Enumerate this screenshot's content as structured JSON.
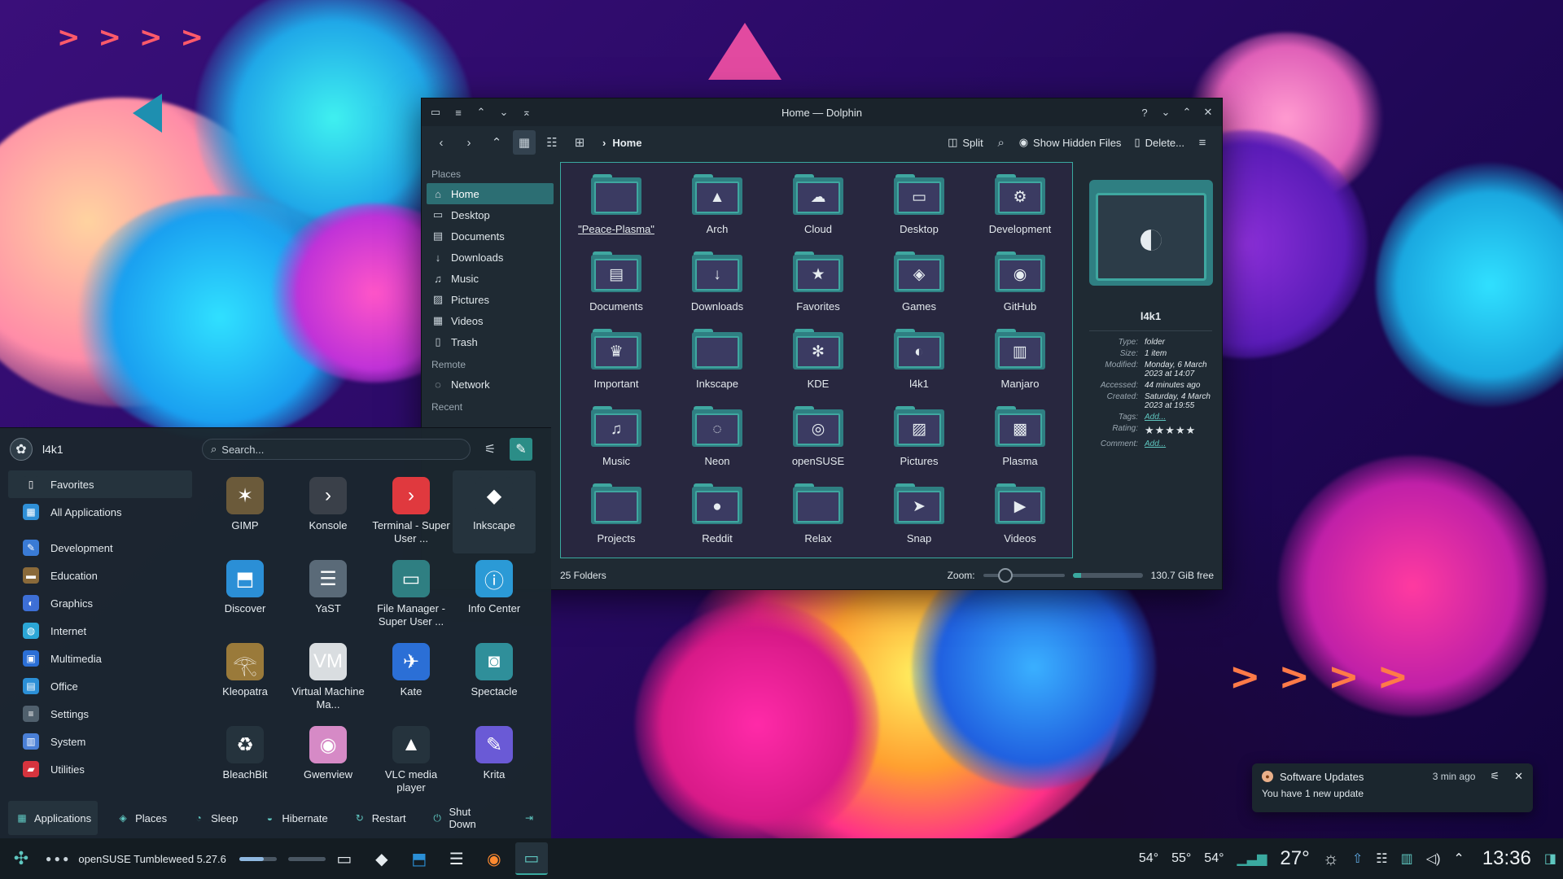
{
  "dolphin": {
    "title": "Home — Dolphin",
    "breadcrumb": "Home",
    "toolbar": {
      "split": "Split",
      "hidden": "Show Hidden Files",
      "delete": "Delete..."
    },
    "places_header": "Places",
    "remote_header": "Remote",
    "recent_header": "Recent",
    "places": [
      "Home",
      "Desktop",
      "Documents",
      "Downloads",
      "Music",
      "Pictures",
      "Videos",
      "Trash"
    ],
    "remote": [
      "Network"
    ],
    "folders": [
      {
        "name": "\"Peace-Plasma\"",
        "icon": "blank-folder-icon",
        "glyph": ""
      },
      {
        "name": "Arch",
        "icon": "arch-icon",
        "glyph": "▲"
      },
      {
        "name": "Cloud",
        "icon": "cloud-icon",
        "glyph": "☁"
      },
      {
        "name": "Desktop",
        "icon": "desktop-icon",
        "glyph": "▭"
      },
      {
        "name": "Development",
        "icon": "gear-icon",
        "glyph": "⚙"
      },
      {
        "name": "Documents",
        "icon": "document-icon",
        "glyph": "▤"
      },
      {
        "name": "Downloads",
        "icon": "download-icon",
        "glyph": "↓"
      },
      {
        "name": "Favorites",
        "icon": "star-icon",
        "glyph": "★"
      },
      {
        "name": "Games",
        "icon": "gamepad-icon",
        "glyph": "◈"
      },
      {
        "name": "GitHub",
        "icon": "github-icon",
        "glyph": "◉"
      },
      {
        "name": "Important",
        "icon": "trophy-icon",
        "glyph": "♛"
      },
      {
        "name": "Inkscape",
        "icon": "blank-folder-icon",
        "glyph": ""
      },
      {
        "name": "KDE",
        "icon": "kde-icon",
        "glyph": "✻"
      },
      {
        "name": "l4k1",
        "icon": "chameleon-icon",
        "glyph": "◐"
      },
      {
        "name": "Manjaro",
        "icon": "manjaro-icon",
        "glyph": "▥"
      },
      {
        "name": "Music",
        "icon": "music-icon",
        "glyph": "♫"
      },
      {
        "name": "Neon",
        "icon": "neon-icon",
        "glyph": "◌"
      },
      {
        "name": "openSUSE",
        "icon": "opensuse-icon",
        "glyph": "◎"
      },
      {
        "name": "Pictures",
        "icon": "picture-icon",
        "glyph": "▨"
      },
      {
        "name": "Plasma",
        "icon": "plasma-icon",
        "glyph": "▩"
      },
      {
        "name": "Projects",
        "icon": "blank-folder-icon",
        "glyph": ""
      },
      {
        "name": "Reddit",
        "icon": "reddit-icon",
        "glyph": "●"
      },
      {
        "name": "Relax",
        "icon": "blank-folder-icon",
        "glyph": ""
      },
      {
        "name": "Snap",
        "icon": "snap-icon",
        "glyph": "➤"
      },
      {
        "name": "Videos",
        "icon": "video-icon",
        "glyph": "▶"
      }
    ],
    "status_count": "25 Folders",
    "zoom_label": "Zoom:",
    "free_space": "130.7 GiB free",
    "capacity_used": 0.12,
    "info": {
      "name": "l4k1",
      "type_k": "Type:",
      "type_v": "folder",
      "size_k": "Size:",
      "size_v": "1 item",
      "modified_k": "Modified:",
      "modified_v": "Monday, 6 March 2023 at 14:07",
      "accessed_k": "Accessed:",
      "accessed_v": "44 minutes ago",
      "created_k": "Created:",
      "created_v": "Saturday, 4 March 2023 at 19:55",
      "tags_k": "Tags:",
      "tags_v": "Add...",
      "rating_k": "Rating:",
      "rating_v": "★★★★★",
      "comment_k": "Comment:",
      "comment_v": "Add..."
    }
  },
  "launcher": {
    "user": "l4k1",
    "search_placeholder": "Search...",
    "categories": [
      {
        "label": "Favorites",
        "icon": "bookmark-icon",
        "color": "#25333d",
        "glyph": "▯"
      },
      {
        "label": "All Applications",
        "icon": "grid-icon",
        "color": "#2f8fd6",
        "glyph": "▦"
      },
      {
        "label": "Development",
        "icon": "hammer-icon",
        "color": "#3a7bd5",
        "glyph": "✎"
      },
      {
        "label": "Education",
        "icon": "chalkboard-icon",
        "color": "#8a6a3a",
        "glyph": "▬"
      },
      {
        "label": "Graphics",
        "icon": "palette-icon",
        "color": "#3d6fd6",
        "glyph": "◐"
      },
      {
        "label": "Internet",
        "icon": "globe-icon",
        "color": "#2ba6d6",
        "glyph": "◍"
      },
      {
        "label": "Multimedia",
        "icon": "media-icon",
        "color": "#2b6fd6",
        "glyph": "▣"
      },
      {
        "label": "Office",
        "icon": "office-icon",
        "color": "#2b8fd6",
        "glyph": "▤"
      },
      {
        "label": "Settings",
        "icon": "settings-icon",
        "color": "#50606d",
        "glyph": "≡"
      },
      {
        "label": "System",
        "icon": "system-icon",
        "color": "#4a7fd6",
        "glyph": "▥"
      },
      {
        "label": "Utilities",
        "icon": "toolbox-icon",
        "color": "#d6343e",
        "glyph": "▰"
      }
    ],
    "apps": [
      {
        "label": "GIMP",
        "icon": "gimp-icon",
        "color": "#6b5a3a",
        "glyph": "✶"
      },
      {
        "label": "Konsole",
        "icon": "konsole-icon",
        "color": "#3a4049",
        "glyph": "›"
      },
      {
        "label": "Terminal - Super User ...",
        "icon": "terminal-root-icon",
        "color": "#e0393e",
        "glyph": "›"
      },
      {
        "label": "Inkscape",
        "icon": "inkscape-icon",
        "color": "#25333d",
        "glyph": "◆"
      },
      {
        "label": "Discover",
        "icon": "discover-icon",
        "color": "#2b8fd6",
        "glyph": "⬒"
      },
      {
        "label": "YaST",
        "icon": "yast-icon",
        "color": "#5a6a78",
        "glyph": "☰"
      },
      {
        "label": "File Manager - Super User ...",
        "icon": "folder-root-icon",
        "color": "#2f7f82",
        "glyph": "▭"
      },
      {
        "label": "Info Center",
        "icon": "info-icon",
        "color": "#2b9ad6",
        "glyph": "ⓘ"
      },
      {
        "label": "Kleopatra",
        "icon": "kleopatra-icon",
        "color": "#9a7a3a",
        "glyph": "𓂀"
      },
      {
        "label": "Virtual Machine Ma...",
        "icon": "vm-icon",
        "color": "#d9dde0",
        "glyph": "VM"
      },
      {
        "label": "Kate",
        "icon": "kate-icon",
        "color": "#2b6fd6",
        "glyph": "✈"
      },
      {
        "label": "Spectacle",
        "icon": "spectacle-icon",
        "color": "#2f8f9a",
        "glyph": "◙"
      },
      {
        "label": "BleachBit",
        "icon": "bleachbit-icon",
        "color": "#25333d",
        "glyph": "♻"
      },
      {
        "label": "Gwenview",
        "icon": "gwenview-icon",
        "color": "#d68ac6",
        "glyph": "◉"
      },
      {
        "label": "VLC media player",
        "icon": "vlc-icon",
        "color": "#25333d",
        "glyph": "▲"
      },
      {
        "label": "Krita",
        "icon": "krita-icon",
        "color": "#6a5ad6",
        "glyph": "✎"
      }
    ],
    "footer": {
      "applications": "Applications",
      "places": "Places",
      "sleep": "Sleep",
      "hibernate": "Hibernate",
      "restart": "Restart",
      "shutdown": "Shut Down"
    }
  },
  "notification": {
    "app": "Software Updates",
    "time": "3 min ago",
    "body": "You have 1 new update"
  },
  "panel": {
    "distro": "openSUSE Tumbleweed 5.27.6",
    "temps": [
      "54°",
      "55°",
      "54°"
    ],
    "weather": "27°",
    "clock": "13:36"
  },
  "colors": {
    "accent": "#3aa99f",
    "panel": "#141c22",
    "window": "#1f2a33"
  }
}
